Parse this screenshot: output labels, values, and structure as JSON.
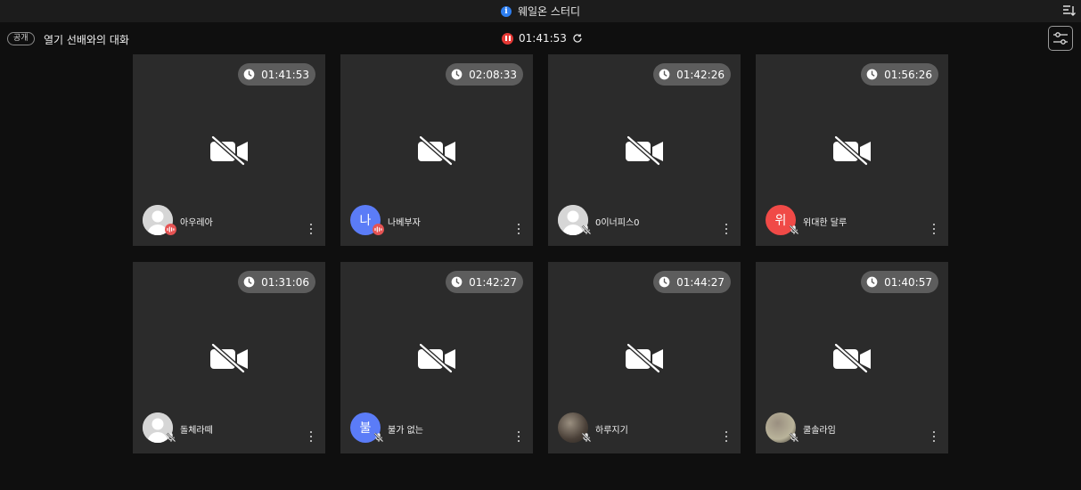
{
  "titlebar": {
    "title": "웨일온 스터디",
    "info_icon": "info-icon",
    "sort_icon": "sort-icon"
  },
  "header": {
    "badge": "공개",
    "room_title": "열기 선배와의 대화",
    "timer": "01:41:53",
    "timer_icon": "pause-icon",
    "refresh_icon": "refresh-icon",
    "settings_icon": "sliders-icon"
  },
  "colors": {
    "background": "#0f0f0f",
    "tile": "#2b2b2b",
    "pill": "#5d5d5d",
    "speaking": "#e55353",
    "record": "#e53935"
  },
  "participants": [
    {
      "name": "아우레아",
      "time": "01:41:53",
      "avatar_type": "default",
      "status": "speaking"
    },
    {
      "name": "나베부자",
      "time": "02:08:33",
      "avatar_type": "initial",
      "initial": "나",
      "avatar_color": "#5b7cf7",
      "status": "speaking"
    },
    {
      "name": "0이너피스0",
      "time": "01:42:26",
      "avatar_type": "default",
      "status": "muted"
    },
    {
      "name": "위대한 달루",
      "time": "01:56:26",
      "avatar_type": "initial",
      "initial": "위",
      "avatar_color": "#f04a47",
      "status": "muted"
    },
    {
      "name": "돌체라떼",
      "time": "01:31:06",
      "avatar_type": "default",
      "status": "muted"
    },
    {
      "name": "불가 없는",
      "time": "01:42:27",
      "avatar_type": "initial",
      "initial": "불",
      "avatar_color": "#5b7cf7",
      "status": "muted"
    },
    {
      "name": "하루지기",
      "time": "01:44:27",
      "avatar_type": "photo",
      "avatar_color": "#4a4038",
      "status": "muted"
    },
    {
      "name": "쿨솔라임",
      "time": "01:40:57",
      "avatar_type": "photo",
      "avatar_color": "#b9b39a",
      "status": "muted"
    }
  ],
  "tile_icons": {
    "clock": "clock-icon",
    "camera": "camera-off-icon",
    "more": "more-vertical-icon"
  }
}
